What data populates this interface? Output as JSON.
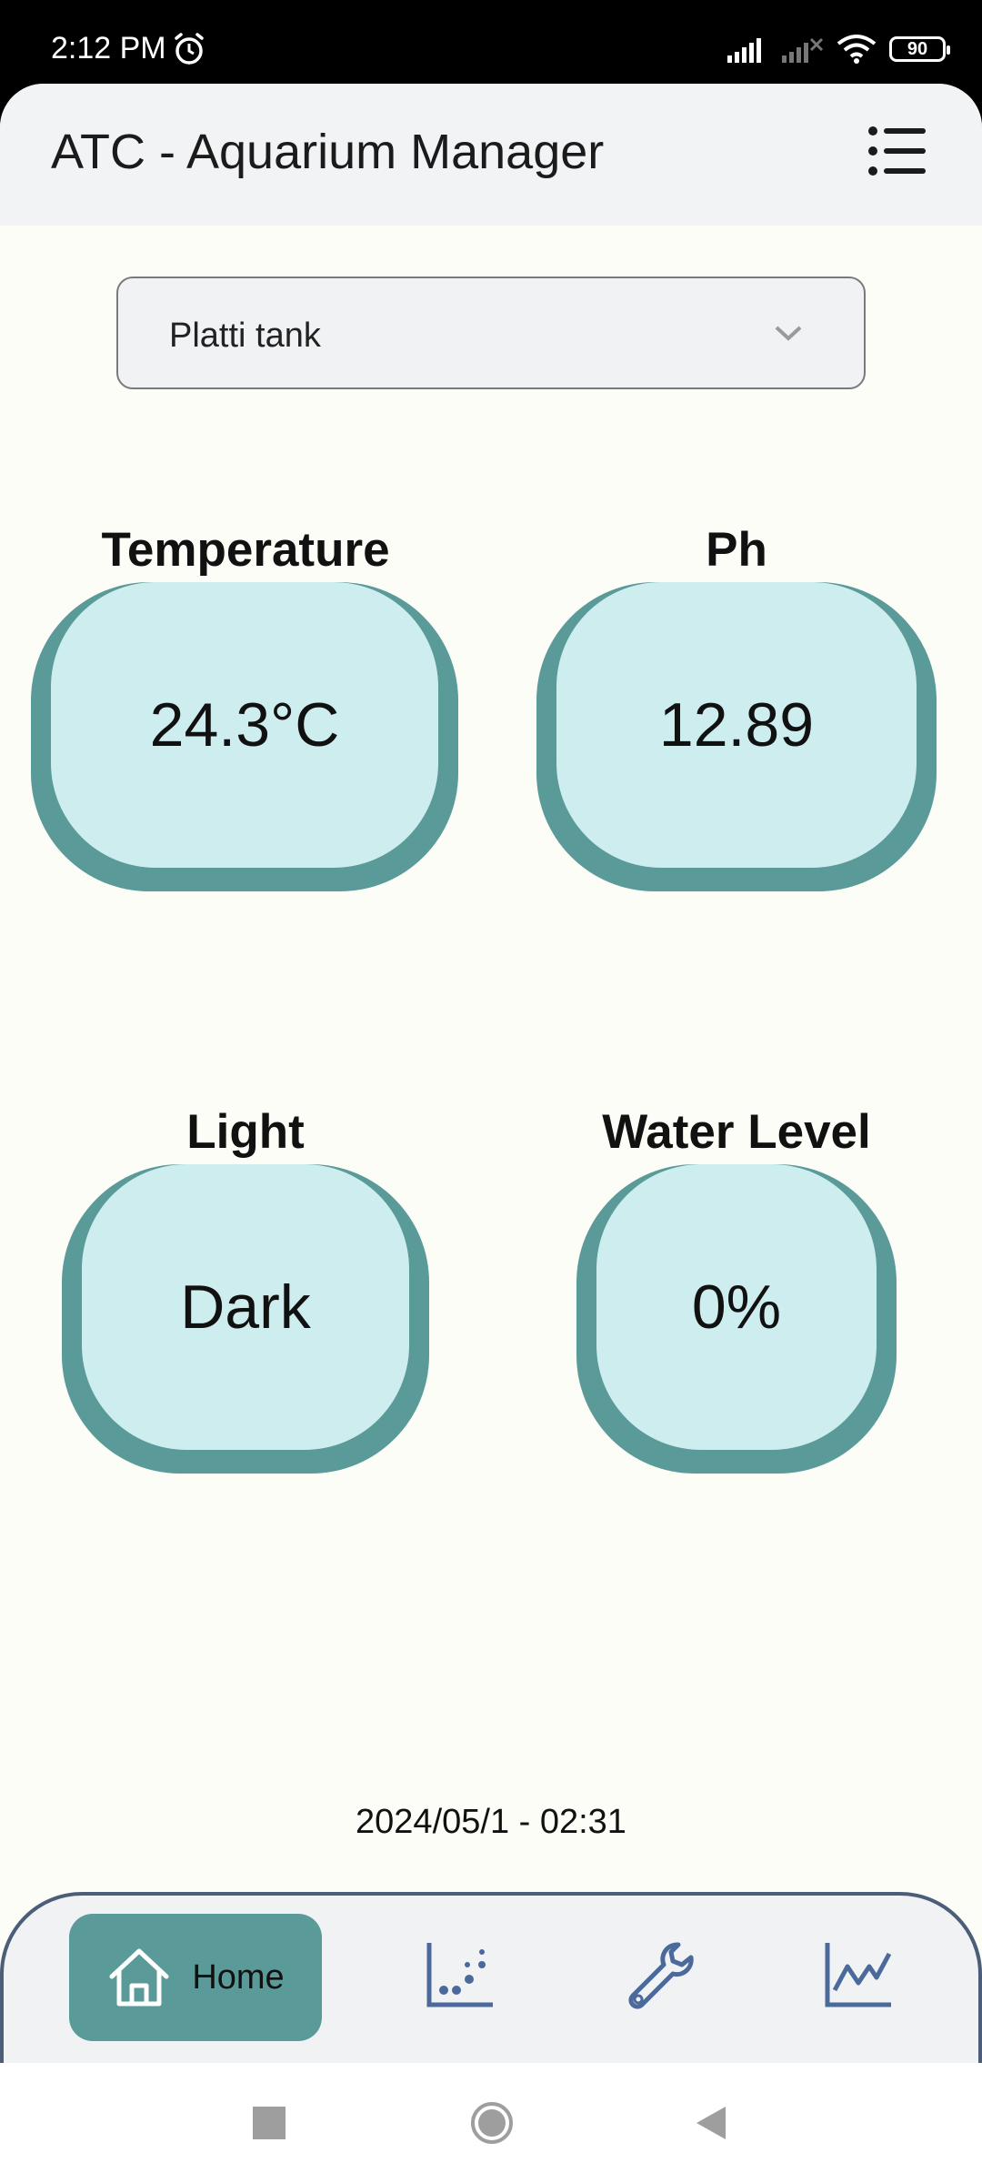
{
  "status_bar": {
    "time": "2:12 PM",
    "battery": "90"
  },
  "app": {
    "title": "ATC - Aquarium Manager"
  },
  "tank_selector": {
    "value": "Platti tank"
  },
  "metrics": {
    "temperature": {
      "label": "Temperature",
      "value": "24.3°C"
    },
    "ph": {
      "label": "Ph",
      "value": "12.89"
    },
    "light": {
      "label": "Light",
      "value": "Dark"
    },
    "water_level": {
      "label": "Water Level",
      "value": "0%"
    }
  },
  "timestamp": "2024/05/1 - 02:31",
  "bottom_nav": {
    "items": [
      {
        "label": "Home",
        "icon": "home-icon",
        "active": true
      },
      {
        "label": "",
        "icon": "scatter-chart-icon"
      },
      {
        "label": "",
        "icon": "wrench-icon"
      },
      {
        "label": "",
        "icon": "line-chart-icon"
      }
    ]
  },
  "colors": {
    "accent": "#5a9a98",
    "tile_fill": "#cdedef",
    "nav_border": "#4b5d78",
    "background": "#fdfdf7"
  }
}
